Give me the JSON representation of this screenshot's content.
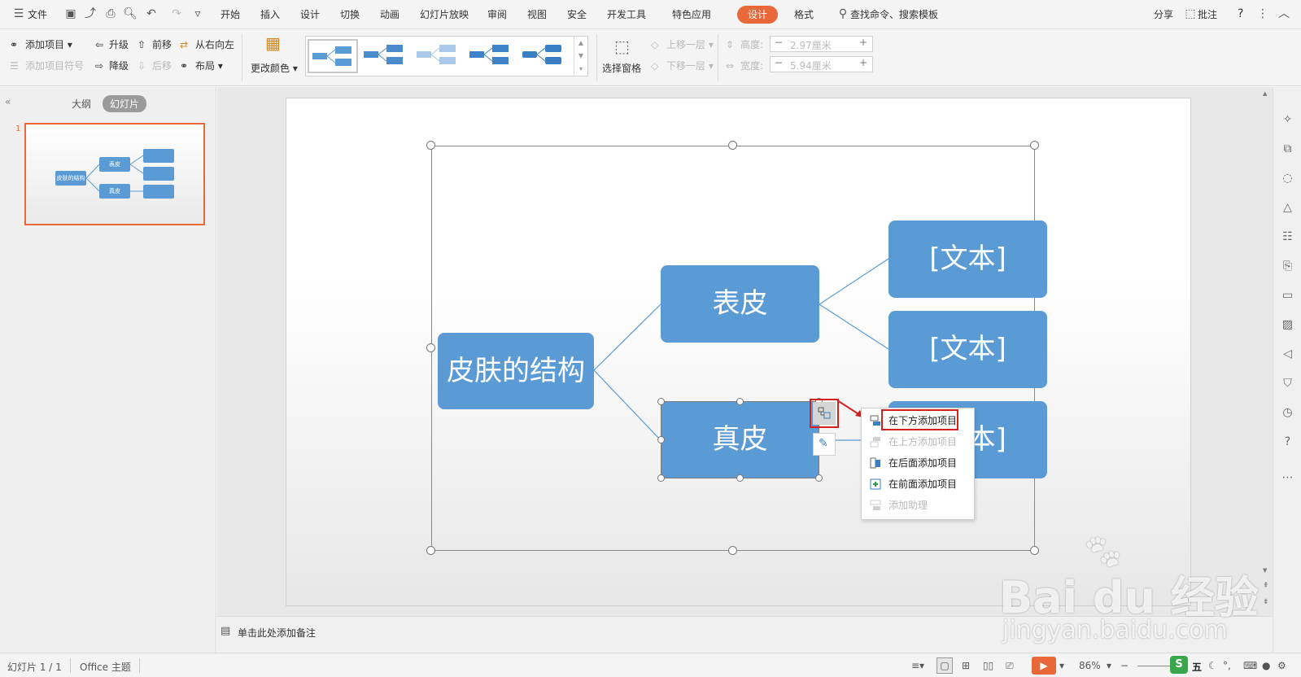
{
  "menubar": {
    "file_label": "文件",
    "tabs": [
      "开始",
      "插入",
      "设计",
      "切换",
      "动画",
      "幻灯片放映",
      "审阅",
      "视图",
      "安全",
      "开发工具",
      "特色应用",
      "设计",
      "格式"
    ],
    "active_tab": "设计",
    "search_label": "查找命令、搜索模板",
    "share_label": "分享",
    "comment_label": "批注",
    "help_label": "?"
  },
  "ribbon": {
    "add_item": "添加项目",
    "add_bullet": "添加项目符号",
    "promote": "升级",
    "demote": "降级",
    "move_up": "前移",
    "move_down": "后移",
    "right_to_left": "从右向左",
    "layout": "布局",
    "change_color": "更改颜色",
    "select_pane": "选择窗格",
    "bring_forward": "上移一层",
    "send_backward": "下移一层",
    "height_label": "高度:",
    "height_value": "2.97厘米",
    "width_label": "宽度:",
    "width_value": "5.94厘米"
  },
  "left_panel": {
    "tab_outline": "大纲",
    "tab_slides": "幻灯片",
    "slide_number": "1",
    "thumb_root": "皮肤的结构",
    "thumb_a": "表皮",
    "thumb_b": "真皮"
  },
  "slide": {
    "root": "皮肤的结构",
    "child_top": "表皮",
    "child_bottom": "真皮",
    "leaf_1": "[文本]",
    "leaf_2": "[文本]",
    "leaf_3": "[文本]"
  },
  "context_menu": {
    "items": [
      {
        "label": "在下方添加项目",
        "enabled": true
      },
      {
        "label": "在上方添加项目",
        "enabled": false
      },
      {
        "label": "在后面添加项目",
        "enabled": true
      },
      {
        "label": "在前面添加项目",
        "enabled": true
      },
      {
        "label": "添加助理",
        "enabled": false
      }
    ]
  },
  "notes": {
    "placeholder": "单击此处添加备注"
  },
  "status": {
    "slide_info": "幻灯片 1 / 1",
    "theme": "Office 主题",
    "zoom": "86%"
  },
  "watermark": {
    "brand": "Bai du 经验",
    "url": "jingyan.baidu.com"
  },
  "colors": {
    "accent": "#e8683a",
    "smartart": "#5b9bd5",
    "highlight": "#d61f1f"
  }
}
